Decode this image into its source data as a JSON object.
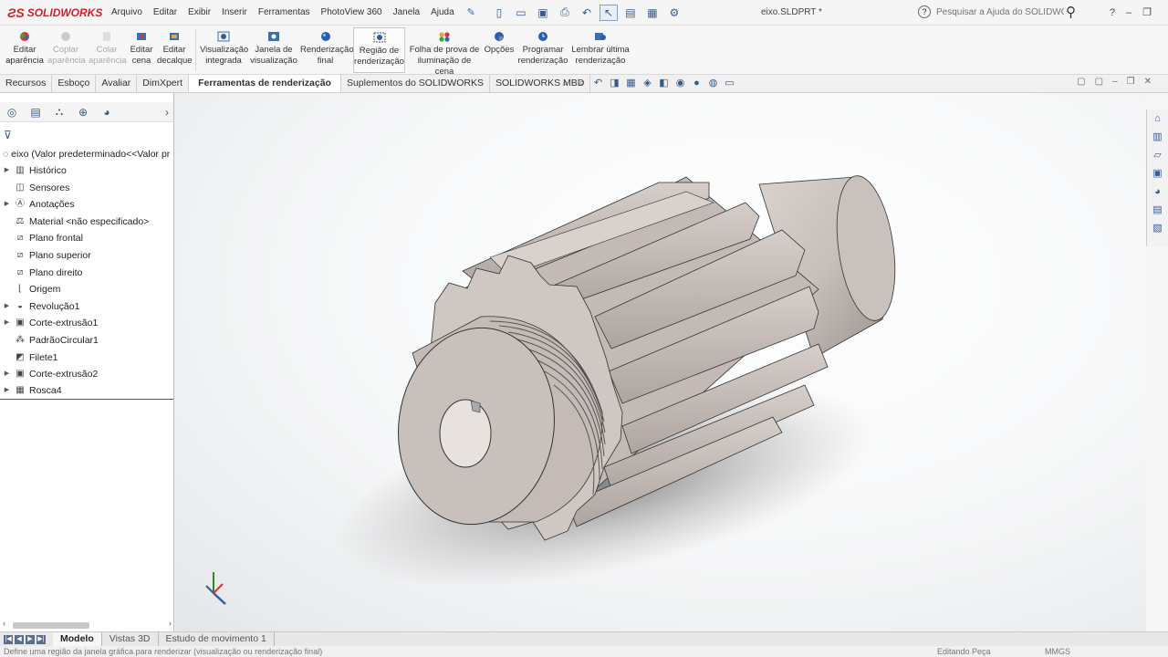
{
  "app": {
    "brand": "SOLIDWORKS",
    "document_title": "eixo.SLDPRT *"
  },
  "menu": [
    "Arquivo",
    "Editar",
    "Exibir",
    "Inserir",
    "Ferramentas",
    "PhotoView 360",
    "Janela",
    "Ajuda"
  ],
  "search": {
    "placeholder": "Pesquisar a Ajuda do SOLIDWORKS"
  },
  "ribbon": [
    {
      "line1": "Editar",
      "line2": "aparência",
      "icon": "appearance-icon",
      "enabled": true
    },
    {
      "line1": "Copiar",
      "line2": "aparência",
      "icon": "copy-appearance-icon",
      "enabled": false
    },
    {
      "line1": "Colar",
      "line2": "aparência",
      "icon": "paste-appearance-icon",
      "enabled": false
    },
    {
      "line1": "Editar",
      "line2": "cena",
      "icon": "scene-icon",
      "enabled": true
    },
    {
      "line1": "Editar",
      "line2": "decalque",
      "icon": "decal-icon",
      "enabled": true
    },
    {
      "line1": "Visualização",
      "line2": "integrada",
      "icon": "integrated-preview-icon",
      "enabled": true
    },
    {
      "line1": "Janela de",
      "line2": "visualização",
      "icon": "preview-window-icon",
      "enabled": true
    },
    {
      "line1": "Renderização",
      "line2": "final",
      "icon": "final-render-icon",
      "enabled": true
    },
    {
      "line1": "Região de",
      "line2": "renderização",
      "icon": "render-region-icon",
      "enabled": true,
      "active": true
    },
    {
      "line1": "Folha de prova de",
      "line2": "iluminação de cena",
      "icon": "lighting-proof-icon",
      "enabled": true
    },
    {
      "line1": "Opções",
      "line2": "",
      "icon": "options-icon",
      "enabled": true
    },
    {
      "line1": "Programar",
      "line2": "renderização",
      "icon": "schedule-render-icon",
      "enabled": true
    },
    {
      "line1": "Lembrar última",
      "line2": "renderização",
      "icon": "recall-render-icon",
      "enabled": true
    }
  ],
  "command_tabs": [
    "Recursos",
    "Esboço",
    "Avaliar",
    "DimXpert",
    "Ferramentas de renderização",
    "Suplementos do SOLIDWORKS",
    "SOLIDWORKS MBD"
  ],
  "active_command_tab": "Ferramentas de renderização",
  "tree": {
    "root": "eixo  (Valor predeterminado<<Valor pr",
    "items": [
      {
        "label": "Histórico",
        "icon": "history-icon",
        "expandable": true
      },
      {
        "label": "Sensores",
        "icon": "sensor-icon",
        "expandable": false
      },
      {
        "label": "Anotações",
        "icon": "annotation-icon",
        "expandable": true
      },
      {
        "label": "Material <não especificado>",
        "icon": "material-icon",
        "expandable": false
      },
      {
        "label": "Plano frontal",
        "icon": "plane-icon",
        "expandable": false
      },
      {
        "label": "Plano superior",
        "icon": "plane-icon",
        "expandable": false
      },
      {
        "label": "Plano direito",
        "icon": "plane-icon",
        "expandable": false
      },
      {
        "label": "Origem",
        "icon": "origin-icon",
        "expandable": false
      },
      {
        "label": "Revolução1",
        "icon": "revolve-icon",
        "expandable": true
      },
      {
        "label": "Corte-extrusão1",
        "icon": "cut-extrude-icon",
        "expandable": true
      },
      {
        "label": "PadrãoCircular1",
        "icon": "circular-pattern-icon",
        "expandable": false
      },
      {
        "label": "Filete1",
        "icon": "fillet-icon",
        "expandable": false
      },
      {
        "label": "Corte-extrusão2",
        "icon": "cut-extrude-icon",
        "expandable": true
      },
      {
        "label": "Rosca4",
        "icon": "thread-icon",
        "expandable": true
      }
    ]
  },
  "bottom_tabs": [
    "Modelo",
    "Vistas 3D",
    "Estudo de movimento 1"
  ],
  "active_bottom_tab": "Modelo",
  "status": {
    "message": "Define uma região da janela gráfica para renderizar (visualização ou renderização final)",
    "mode": "Editando Peça",
    "units": "MMGS"
  },
  "colors": {
    "accent": "#2a5ea8",
    "brand": "#d0212a",
    "gear": "#bfb6b1"
  }
}
